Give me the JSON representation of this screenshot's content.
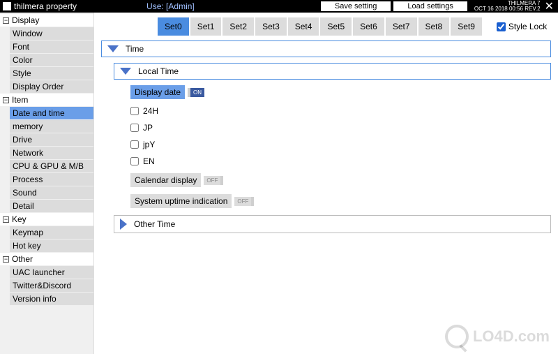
{
  "titlebar": {
    "title": "thilmera property",
    "use": "Use: [Admin]",
    "save": "Save setting",
    "load": "Load settings",
    "meta_line1": "THILMERA 7",
    "meta_line2": "OCT 16 2018 00:56 REV.2",
    "close": "✕"
  },
  "sidebar": {
    "groups": [
      {
        "label": "Display",
        "items": [
          "Window",
          "Font",
          "Color",
          "Style",
          "Display Order"
        ]
      },
      {
        "label": "Item",
        "items": [
          "Date and time",
          "memory",
          "Drive",
          "Network",
          "CPU & GPU & M/B",
          "Process",
          "Sound",
          "Detail"
        ]
      },
      {
        "label": "Key",
        "items": [
          "Keymap",
          "Hot key"
        ]
      },
      {
        "label": "Other",
        "items": [
          "UAC launcher",
          "Twitter&Discord",
          "Version info"
        ]
      }
    ],
    "selected": "Date and time"
  },
  "tabs": {
    "items": [
      "Set0",
      "Set1",
      "Set2",
      "Set3",
      "Set4",
      "Set5",
      "Set6",
      "Set7",
      "Set8",
      "Set9"
    ],
    "active": "Set0",
    "style_lock": "Style Lock"
  },
  "panel": {
    "time_hdr": "Time",
    "local_time_hdr": "Local Time",
    "display_date": "Display date",
    "on": "ON",
    "off": "OFF",
    "opt_24h": "24H",
    "opt_jp": "JP",
    "opt_jpy": "jpY",
    "opt_en": "EN",
    "calendar": "Calendar display",
    "uptime": "System uptime indication",
    "other_time": "Other Time"
  },
  "watermark": "LO4D.com",
  "minus": "−"
}
